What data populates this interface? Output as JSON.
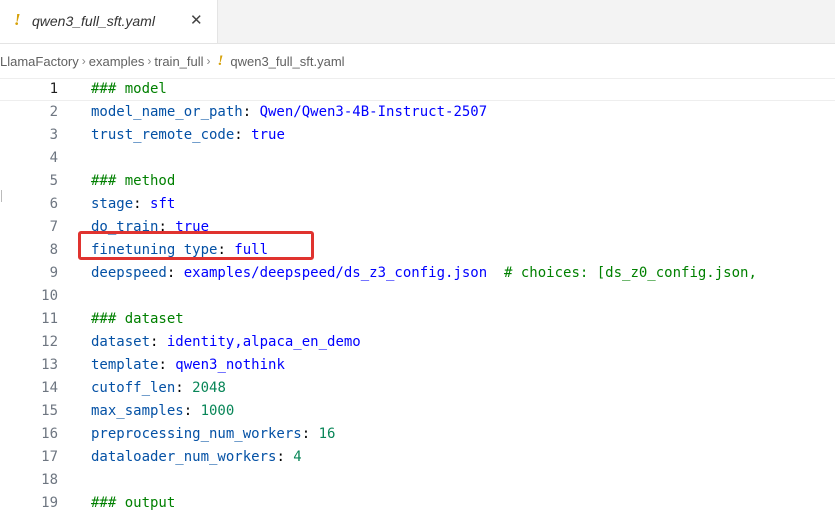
{
  "tab": {
    "icon": "!",
    "title": "qwen3_full_sft.yaml",
    "close": "✕"
  },
  "breadcrumb": {
    "items": [
      "LlamaFactory",
      "examples",
      "train_full"
    ],
    "file_icon": "!",
    "file": "qwen3_full_sft.yaml",
    "separator": "›"
  },
  "editor": {
    "lines": [
      {
        "n": "1",
        "parts": [
          {
            "t": "### model",
            "c": "comment"
          }
        ]
      },
      {
        "n": "2",
        "parts": [
          {
            "t": "model_name_or_path",
            "c": "key"
          },
          {
            "t": ": ",
            "c": "plain"
          },
          {
            "t": "Qwen/Qwen3-4B-Instruct-2507",
            "c": "val"
          }
        ]
      },
      {
        "n": "3",
        "parts": [
          {
            "t": "trust_remote_code",
            "c": "key"
          },
          {
            "t": ": ",
            "c": "plain"
          },
          {
            "t": "true",
            "c": "val"
          }
        ]
      },
      {
        "n": "4",
        "parts": []
      },
      {
        "n": "5",
        "parts": [
          {
            "t": "### method",
            "c": "comment"
          }
        ]
      },
      {
        "n": "6",
        "parts": [
          {
            "t": "stage",
            "c": "key"
          },
          {
            "t": ": ",
            "c": "plain"
          },
          {
            "t": "sft",
            "c": "val"
          }
        ]
      },
      {
        "n": "7",
        "parts": [
          {
            "t": "do_train",
            "c": "key"
          },
          {
            "t": ": ",
            "c": "plain"
          },
          {
            "t": "true",
            "c": "val"
          }
        ]
      },
      {
        "n": "8",
        "parts": [
          {
            "t": "finetuning_type",
            "c": "key"
          },
          {
            "t": ": ",
            "c": "plain"
          },
          {
            "t": "full",
            "c": "val"
          }
        ]
      },
      {
        "n": "9",
        "parts": [
          {
            "t": "deepspeed",
            "c": "key"
          },
          {
            "t": ": ",
            "c": "plain"
          },
          {
            "t": "examples/deepspeed/ds_z3_config.json",
            "c": "val"
          },
          {
            "t": "  # choices: [ds_z0_config.json,",
            "c": "comment"
          }
        ]
      },
      {
        "n": "10",
        "parts": []
      },
      {
        "n": "11",
        "parts": [
          {
            "t": "### dataset",
            "c": "comment"
          }
        ]
      },
      {
        "n": "12",
        "parts": [
          {
            "t": "dataset",
            "c": "key"
          },
          {
            "t": ": ",
            "c": "plain"
          },
          {
            "t": "identity,alpaca_en_demo",
            "c": "val"
          }
        ]
      },
      {
        "n": "13",
        "parts": [
          {
            "t": "template",
            "c": "key"
          },
          {
            "t": ": ",
            "c": "plain"
          },
          {
            "t": "qwen3_nothink",
            "c": "val"
          }
        ]
      },
      {
        "n": "14",
        "parts": [
          {
            "t": "cutoff_len",
            "c": "key"
          },
          {
            "t": ": ",
            "c": "plain"
          },
          {
            "t": "2048",
            "c": "num"
          }
        ]
      },
      {
        "n": "15",
        "parts": [
          {
            "t": "max_samples",
            "c": "key"
          },
          {
            "t": ": ",
            "c": "plain"
          },
          {
            "t": "1000",
            "c": "num"
          }
        ]
      },
      {
        "n": "16",
        "parts": [
          {
            "t": "preprocessing_num_workers",
            "c": "key"
          },
          {
            "t": ": ",
            "c": "plain"
          },
          {
            "t": "16",
            "c": "num"
          }
        ]
      },
      {
        "n": "17",
        "parts": [
          {
            "t": "dataloader_num_workers",
            "c": "key"
          },
          {
            "t": ": ",
            "c": "plain"
          },
          {
            "t": "4",
            "c": "num"
          }
        ]
      },
      {
        "n": "18",
        "parts": []
      },
      {
        "n": "19",
        "parts": [
          {
            "t": "### output",
            "c": "comment"
          }
        ]
      }
    ],
    "current_line": "1",
    "highlighted_line": "8"
  },
  "colors": {
    "comment": "#008000",
    "key": "#0451a5",
    "value": "#0000ff",
    "number": "#098658",
    "highlight_box": "#e0332f",
    "yaml_icon": "#d6a10a"
  }
}
